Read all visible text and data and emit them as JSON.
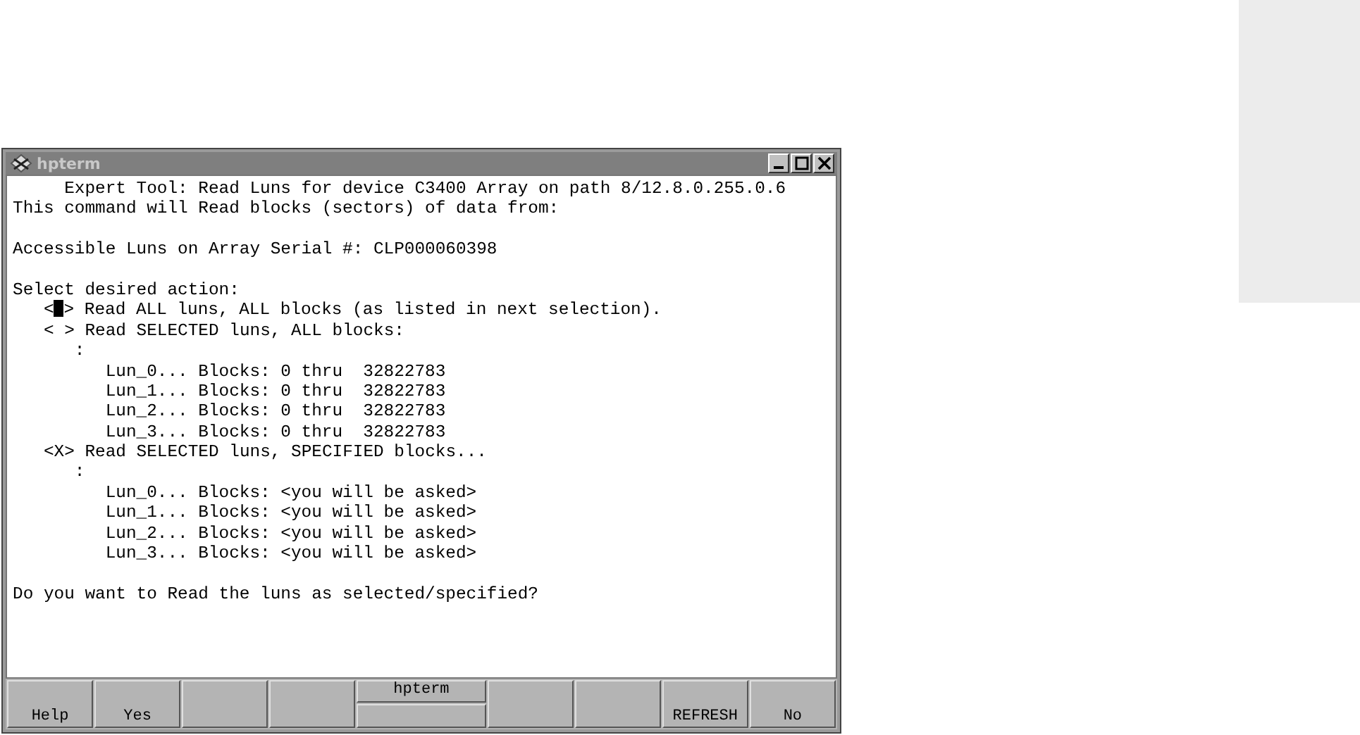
{
  "window": {
    "title": "hpterm"
  },
  "terminal": [
    {
      "kind": "heading",
      "text": "Expert Tool: Read Luns for device C3400 Array on path 8/12.8.0.255.0.6"
    },
    {
      "kind": "text",
      "text": "This command will Read blocks (sectors) of data from:"
    },
    {
      "kind": "blank"
    },
    {
      "kind": "text",
      "text": "Accessible Luns on Array Serial #: CLP000060398"
    },
    {
      "kind": "blank"
    },
    {
      "kind": "text",
      "text": "Select desired action:"
    },
    {
      "kind": "option",
      "open": "<",
      "close": ">",
      "cursor": true,
      "text": "Read ALL luns, ALL blocks (as listed in next selection)."
    },
    {
      "kind": "option",
      "open": "<",
      "close": ">",
      "cursor": false,
      "text": "Read SELECTED luns, ALL blocks:"
    },
    {
      "kind": "colon",
      "text": ":"
    },
    {
      "kind": "lun",
      "text": "Lun_0... Blocks: 0 thru  32822783"
    },
    {
      "kind": "lun",
      "text": "Lun_1... Blocks: 0 thru  32822783"
    },
    {
      "kind": "lun",
      "text": "Lun_2... Blocks: 0 thru  32822783"
    },
    {
      "kind": "lun",
      "text": "Lun_3... Blocks: 0 thru  32822783"
    },
    {
      "kind": "option",
      "open": "<",
      "close": ">",
      "cursor": false,
      "mark": "X",
      "text": "Read SELECTED luns, SPECIFIED blocks..."
    },
    {
      "kind": "colon",
      "text": ":"
    },
    {
      "kind": "lun",
      "text": "Lun_0... Blocks: <you will be asked>"
    },
    {
      "kind": "lun",
      "text": "Lun_1... Blocks: <you will be asked>"
    },
    {
      "kind": "lun",
      "text": "Lun_2... Blocks: <you will be asked>"
    },
    {
      "kind": "lun",
      "text": "Lun_3... Blocks: <you will be asked>"
    },
    {
      "kind": "blank"
    },
    {
      "kind": "text",
      "text": "Do you want to Read the luns as selected/specified?"
    }
  ],
  "function_keys": [
    {
      "kind": "label",
      "label": "Help"
    },
    {
      "kind": "label",
      "label": "Yes"
    },
    {
      "kind": "blank"
    },
    {
      "kind": "blank"
    },
    {
      "kind": "window",
      "top_label": "hpterm"
    },
    {
      "kind": "blank"
    },
    {
      "kind": "blank"
    },
    {
      "kind": "label",
      "label": "REFRESH"
    },
    {
      "kind": "label",
      "label": "No"
    }
  ]
}
